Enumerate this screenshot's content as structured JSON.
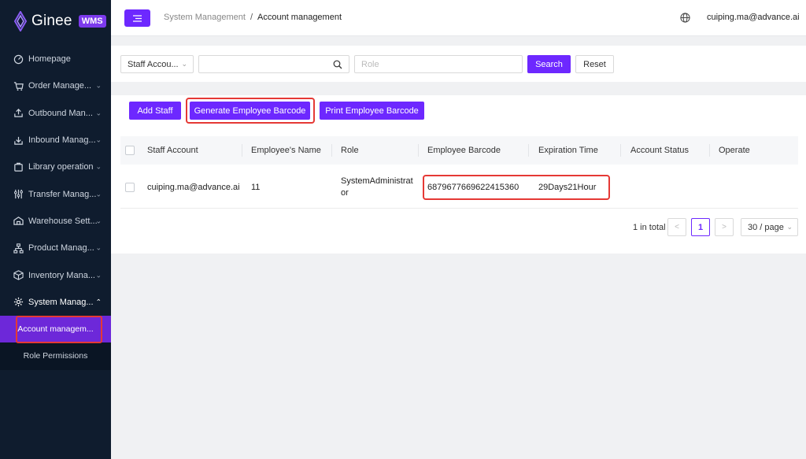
{
  "brand": {
    "name": "Ginee",
    "badge": "WMS"
  },
  "sidebar": {
    "items": [
      {
        "label": "Homepage",
        "icon": "dashboard-icon",
        "chevron": ""
      },
      {
        "label": "Order Manage...",
        "icon": "cart-icon",
        "chevron": "⌄"
      },
      {
        "label": "Outbound Man...",
        "icon": "outbound-icon",
        "chevron": "⌄"
      },
      {
        "label": "Inbound Manag...",
        "icon": "inbound-icon",
        "chevron": "⌄"
      },
      {
        "label": "Library operation",
        "icon": "library-icon",
        "chevron": "⌄"
      },
      {
        "label": "Transfer Manag...",
        "icon": "transfer-icon",
        "chevron": "⌄"
      },
      {
        "label": "Warehouse Sett...",
        "icon": "warehouse-icon",
        "chevron": "⌄"
      },
      {
        "label": "Product Manag...",
        "icon": "product-icon",
        "chevron": "⌄"
      },
      {
        "label": "Inventory Mana...",
        "icon": "inventory-icon",
        "chevron": "⌄"
      },
      {
        "label": "System Manag...",
        "icon": "gear-icon",
        "chevron": "⌃"
      }
    ],
    "submenu": [
      {
        "label": "Account managem...",
        "active": true
      },
      {
        "label": "Role Permissions",
        "active": false
      }
    ]
  },
  "header": {
    "breadcrumb": [
      "System Management",
      "Account management"
    ],
    "separator": "/",
    "user_email": "cuiping.ma@advance.ai"
  },
  "filter": {
    "select_value": "Staff Accou...",
    "search_value": "",
    "role_placeholder": "Role",
    "search_label": "Search",
    "reset_label": "Reset"
  },
  "actions": {
    "add_staff": "Add Staff",
    "generate_barcode": "Generate Employee Barcode",
    "print_barcode": "Print Employee Barcode"
  },
  "table": {
    "columns": [
      "Staff Account",
      "Employee's Name",
      "Role",
      "Employee Barcode",
      "Expiration Time",
      "Account Status",
      "Operate"
    ],
    "rows": [
      {
        "staff_account": "cuiping.ma@advance.ai",
        "employee_name": "11",
        "role": "SystemAdministrator",
        "barcode": "6879677669622415360",
        "expiration": "29Days21Hour",
        "status": "",
        "operate": ""
      }
    ]
  },
  "pagination": {
    "total_text": "1 in total",
    "current_page": "1",
    "page_size": "30 / page",
    "prev": "<",
    "next": ">"
  },
  "colors": {
    "accent": "#6d28ff",
    "sidebar_bg": "#0f1c2e",
    "highlight": "#e53935"
  }
}
